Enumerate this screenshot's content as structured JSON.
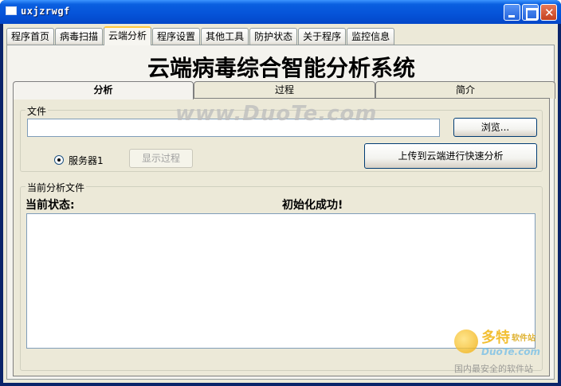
{
  "window": {
    "title": "uxjzrwgf"
  },
  "main_tabs": [
    {
      "label": "程序首页",
      "active": false
    },
    {
      "label": "病毒扫描",
      "active": false
    },
    {
      "label": "云端分析",
      "active": true
    },
    {
      "label": "程序设置",
      "active": false
    },
    {
      "label": "其他工具",
      "active": false
    },
    {
      "label": "防护状态",
      "active": false
    },
    {
      "label": "关于程序",
      "active": false
    },
    {
      "label": "监控信息",
      "active": false
    }
  ],
  "app_title": "云端病毒综合智能分析系统",
  "sub_tabs": [
    {
      "label": "分析",
      "active": true
    },
    {
      "label": "过程",
      "active": false
    },
    {
      "label": "简介",
      "active": false
    }
  ],
  "file_group": {
    "label": "文件",
    "file_value": "",
    "browse_label": "浏览...",
    "server_radio_label": "服务器1",
    "server_radio_checked": true,
    "show_process_label": "显示过程",
    "upload_label": "上传到云端进行快速分析"
  },
  "current_group": {
    "label": "当前分析文件",
    "status_label": "当前状态:",
    "status_value": "初始化成功!",
    "result_text": ""
  },
  "watermark": {
    "text": "www.DuoTe.com",
    "logo_big": "多特",
    "logo_small": "软件站",
    "logo_site": "DuoTe.com",
    "logo_slogan": "国内最安全的软件站"
  }
}
